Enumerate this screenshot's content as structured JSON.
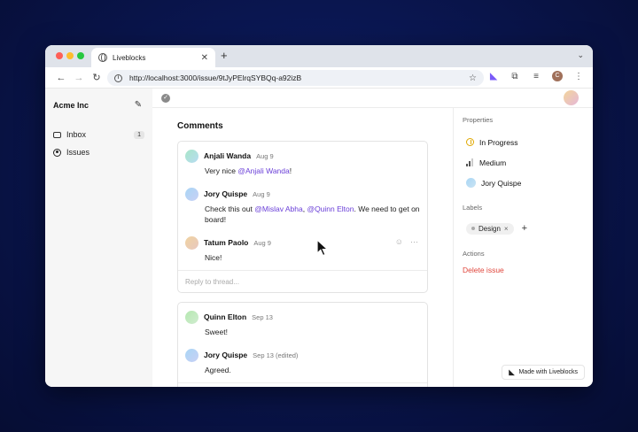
{
  "browser": {
    "tab_title": "Liveblocks",
    "tab_close": "✕",
    "new_tab": "+",
    "url": "http://localhost:3000/issue/9tJyPElrqSYBQq-a92izB",
    "profile_initial": "C"
  },
  "sidebar": {
    "workspace": "Acme Inc",
    "items": [
      {
        "label": "Inbox",
        "badge": "1",
        "icon": "inbox-icon"
      },
      {
        "label": "Issues",
        "badge": "",
        "icon": "issues-icon"
      }
    ]
  },
  "comments": {
    "title": "Comments",
    "reply_placeholder": "Reply to thread...",
    "threads": [
      {
        "comments": [
          {
            "author": "Anjali Wanda",
            "date": "Aug 9",
            "pre": "Very nice ",
            "mention1": "@Anjali Wanda",
            "mid": "!",
            "mention2": "",
            "post": "",
            "avatar": "linear-gradient(135deg,#a8e6c8,#b8dcf2)"
          },
          {
            "author": "Jory Quispe",
            "date": "Aug 9",
            "pre": "Check this out ",
            "mention1": "@Mislav Abha",
            "mid": ", ",
            "mention2": "@Quinn Elton",
            "post": ". We need to get on board!",
            "avatar": "linear-gradient(135deg,#a9d6f5,#c8d0f5)"
          },
          {
            "author": "Tatum Paolo",
            "date": "Aug 9",
            "pre": "Nice!",
            "mention1": "",
            "mid": "",
            "mention2": "",
            "post": "",
            "avatar": "linear-gradient(135deg,#f0d3a0,#e8c8c0)"
          }
        ]
      },
      {
        "comments": [
          {
            "author": "Quinn Elton",
            "date": "Sep 13",
            "pre": "Sweet!",
            "mention1": "",
            "mid": "",
            "mention2": "",
            "post": "",
            "avatar": "linear-gradient(135deg,#b5e8b0,#d0ecd0)"
          },
          {
            "author": "Jory Quispe",
            "date": "Sep 13 (edited)",
            "pre": "Agreed.",
            "mention1": "",
            "mid": "",
            "mention2": "",
            "post": "",
            "avatar": "linear-gradient(135deg,#a9d6f5,#c8d0f5)"
          }
        ]
      }
    ]
  },
  "properties": {
    "title": "Properties",
    "status": "In Progress",
    "priority": "Medium",
    "assignee": "Jory Quispe",
    "labels_title": "Labels",
    "label": "Design",
    "label_remove": "×",
    "add_label": "+",
    "actions_title": "Actions",
    "delete": "Delete issue"
  },
  "footer": {
    "made_with": "Made with Liveblocks"
  },
  "colors": {
    "accent_mention": "#6a3fd8",
    "danger": "#e0463c",
    "in_progress": "#e0a800"
  }
}
